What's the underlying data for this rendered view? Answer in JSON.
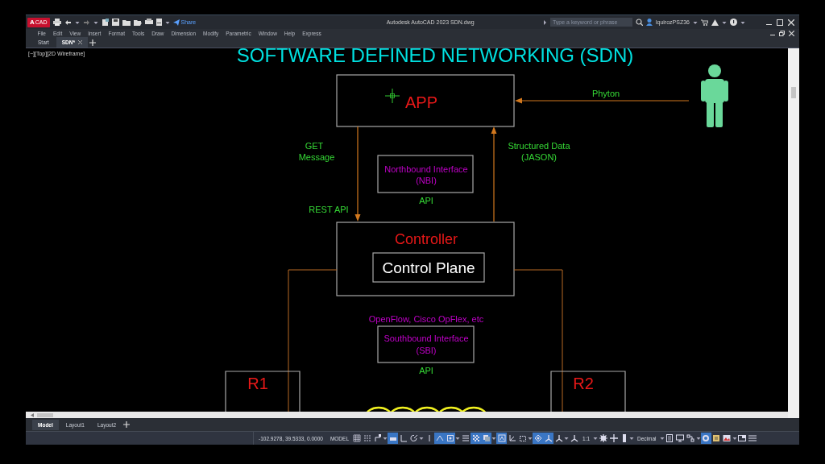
{
  "window": {
    "title": "Autodesk AutoCAD 2023   SDN.dwg"
  },
  "app_button": {
    "label": "A",
    "badge": "CAD"
  },
  "quick_access": {
    "share": "Share"
  },
  "search": {
    "placeholder": "Type a keyword or phrase"
  },
  "user": {
    "name": "lquirozPSZ36"
  },
  "menu": [
    "File",
    "Edit",
    "View",
    "Insert",
    "Format",
    "Tools",
    "Draw",
    "Dimension",
    "Modify",
    "Parametric",
    "Window",
    "Help",
    "Express"
  ],
  "doc_tabs": [
    {
      "label": "Start",
      "selected": false,
      "closable": false
    },
    {
      "label": "SDN*",
      "selected": true,
      "closable": true
    }
  ],
  "viewport_label": "[−][Top][2D Wireframe]",
  "diagram": {
    "title": "SOFTWARE DEFINED NETWORKING (SDN)",
    "app": {
      "label": "APP"
    },
    "user_link": {
      "label": "Phyton"
    },
    "request": {
      "lines": [
        "GET",
        "Message"
      ],
      "protocol": "REST API"
    },
    "response": {
      "lines": [
        "Structured Data",
        "(JASON)"
      ]
    },
    "nbi": {
      "lines": [
        "Northbound Interface",
        "(NBI)"
      ],
      "api": "API"
    },
    "controller": {
      "label": "Controller",
      "inner": "Control Plane"
    },
    "sbi": {
      "protocols": "OpenFlow, Cisco OpFlex, etc",
      "lines": [
        "Southbound Interface",
        "(SBI)"
      ],
      "api": "API"
    },
    "routers": [
      {
        "label": "R1"
      },
      {
        "label": "R2"
      }
    ]
  },
  "layout_tabs": [
    {
      "label": "Model",
      "selected": true
    },
    {
      "label": "Layout1",
      "selected": false
    },
    {
      "label": "Layout2",
      "selected": false
    }
  ],
  "status_bar": {
    "coordinates": "-102.9278, 39.5333, 0.0000",
    "mode": "MODEL",
    "scale": "1:1",
    "units": "Decimal",
    "toggles": [
      {
        "kind": "grid",
        "on": false
      },
      {
        "kind": "dots",
        "on": false
      },
      {
        "kind": "corner",
        "on": false
      },
      {
        "kind": "infer",
        "on": true
      },
      {
        "kind": "ortho",
        "on": false
      },
      {
        "kind": "polar",
        "on": false
      },
      {
        "kind": "line",
        "on": false
      },
      {
        "kind": "iso",
        "on": true
      },
      {
        "kind": "osnap",
        "on": true
      },
      {
        "kind": "lines",
        "on": false
      },
      {
        "kind": "checker",
        "on": true
      },
      {
        "kind": "stack",
        "on": true
      },
      {
        "kind": "annot",
        "on": true
      },
      {
        "kind": "ucs",
        "on": false
      },
      {
        "kind": "select",
        "on": false
      },
      {
        "kind": "gizmo",
        "on": true
      },
      {
        "kind": "tri",
        "on": true
      },
      {
        "kind": "tri",
        "on": false
      },
      {
        "kind": "tri",
        "on": false
      }
    ],
    "tools": [
      {
        "kind": "gear",
        "on": false
      },
      {
        "kind": "plus",
        "on": false
      },
      {
        "kind": "bar",
        "on": false
      }
    ],
    "extras": [
      {
        "kind": "calc",
        "on": false
      },
      {
        "kind": "monitor",
        "on": false
      },
      {
        "kind": "nodes",
        "on": false
      },
      {
        "kind": "clean",
        "on": true
      },
      {
        "kind": "note",
        "on": false
      },
      {
        "kind": "photo",
        "on": false
      },
      {
        "kind": "screen",
        "on": false
      },
      {
        "kind": "menu",
        "on": false
      }
    ]
  }
}
